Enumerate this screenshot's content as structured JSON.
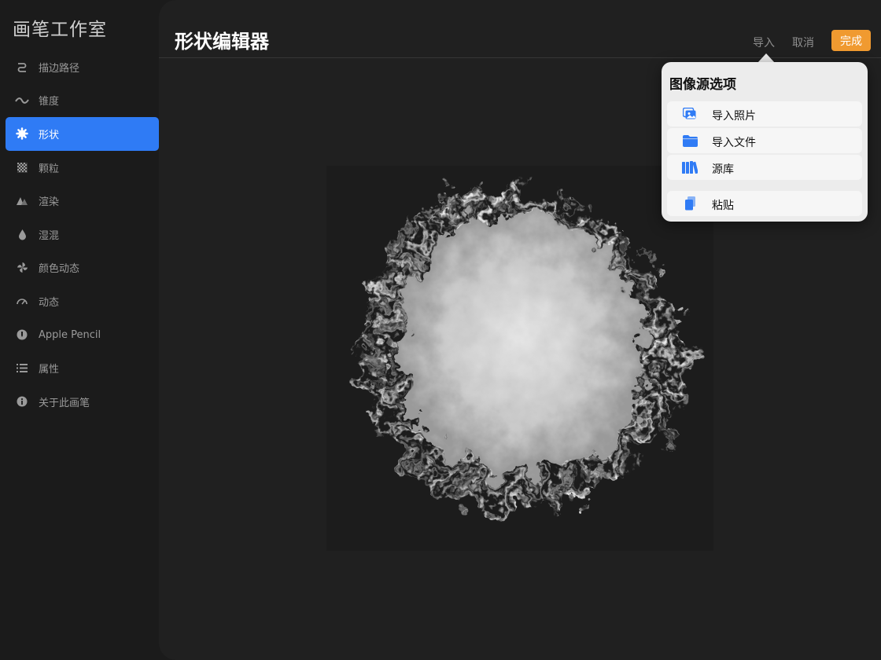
{
  "app": {
    "title": "画笔工作室"
  },
  "sidebar": {
    "items": [
      {
        "label": "描边路径",
        "icon": "stroke-path-icon"
      },
      {
        "label": "锥度",
        "icon": "taper-icon"
      },
      {
        "label": "形状",
        "icon": "shape-icon",
        "active": true
      },
      {
        "label": "颗粒",
        "icon": "grain-icon"
      },
      {
        "label": "渲染",
        "icon": "rendering-icon"
      },
      {
        "label": "湿混",
        "icon": "wet-mix-icon"
      },
      {
        "label": "颜色动态",
        "icon": "color-dynamics-icon"
      },
      {
        "label": "动态",
        "icon": "dynamics-icon"
      },
      {
        "label": "Apple Pencil",
        "icon": "apple-pencil-icon"
      },
      {
        "label": "属性",
        "icon": "properties-icon"
      },
      {
        "label": "关于此画笔",
        "icon": "about-icon"
      }
    ]
  },
  "header": {
    "title": "形状编辑器",
    "import_label": "导入",
    "cancel_label": "取消",
    "done_label": "完成"
  },
  "popover": {
    "title": "图像源选项",
    "items": [
      {
        "label": "导入照片",
        "icon": "photo-icon"
      },
      {
        "label": "导入文件",
        "icon": "folder-icon"
      },
      {
        "label": "源库",
        "icon": "library-icon"
      },
      {
        "label": "粘贴",
        "icon": "paste-icon"
      }
    ]
  },
  "colors": {
    "accent": "#2f7bf5",
    "done_button": "#f09a30",
    "icon_blue": "#2f7bf5"
  }
}
